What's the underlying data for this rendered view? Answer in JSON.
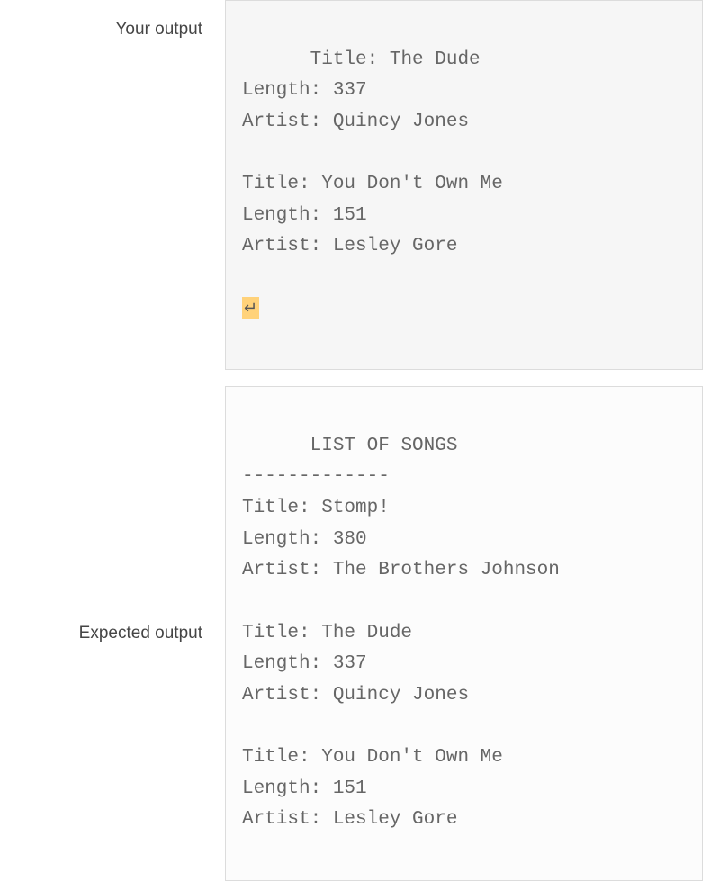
{
  "labels": {
    "your_output": "Your output",
    "expected_output": "Expected output"
  },
  "your_output": {
    "lines": [
      "Title: The Dude",
      "Length: 337",
      "Artist: Quincy Jones",
      "",
      "Title: You Don't Own Me",
      "Length: 151",
      "Artist: Lesley Gore"
    ],
    "trailing_newline_marker": "↵"
  },
  "expected_output": {
    "lines": [
      "LIST OF SONGS",
      "-------------",
      "Title: Stomp!",
      "Length: 380",
      "Artist: The Brothers Johnson",
      "",
      "Title: The Dude",
      "Length: 337",
      "Artist: Quincy Jones",
      "",
      "Title: You Don't Own Me",
      "Length: 151",
      "Artist: Lesley Gore"
    ]
  }
}
